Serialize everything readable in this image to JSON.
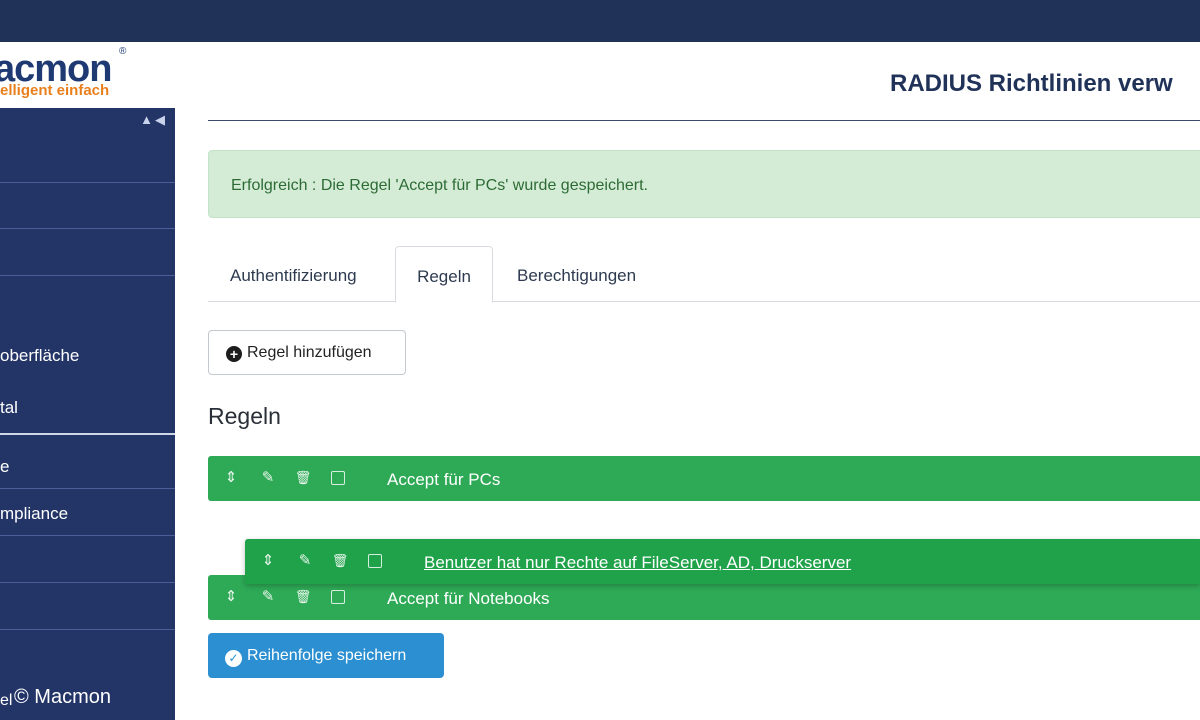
{
  "header": {
    "title": "RADIUS Richtlinien verw",
    "logo_main": "acmon",
    "logo_sub": "elligent einfach",
    "logo_reg": "®"
  },
  "sidebar": {
    "collapse_glyph": "▲◀",
    "items": [
      {
        "label": "oberfläche"
      },
      {
        "label": "tal"
      },
      {
        "label": "e"
      },
      {
        "label": "mpliance"
      },
      {
        "label": "el"
      }
    ]
  },
  "alert": {
    "text": "Erfolgreich :  Die Regel 'Accept für PCs' wurde gespeichert."
  },
  "tabs": [
    {
      "label": "Authentifizierung",
      "active": false
    },
    {
      "label": "Regeln",
      "active": true
    },
    {
      "label": "Berechtigungen",
      "active": false
    }
  ],
  "actions": {
    "add_rule": "Regel hinzufügen",
    "save_order": "Reihenfolge speichern"
  },
  "section_title": "Regeln",
  "rules": [
    {
      "label": "Accept für PCs",
      "dragging": false
    },
    {
      "label": "Benutzer hat nur Rechte auf FileServer, AD, Druckserver",
      "dragging": true
    },
    {
      "label": "Accept für Notebooks",
      "dragging": false
    }
  ],
  "icons": {
    "sort": "⇕",
    "edit": "✎",
    "delete": "🗑"
  },
  "copyright": "© Macmon",
  "colors": {
    "navy": "#213259",
    "sidebar": "#233567",
    "rule_green": "#2eaa56",
    "save_blue": "#2b8fd1",
    "alert_bg": "#d4ecd6",
    "logo_orange": "#e8801e"
  }
}
